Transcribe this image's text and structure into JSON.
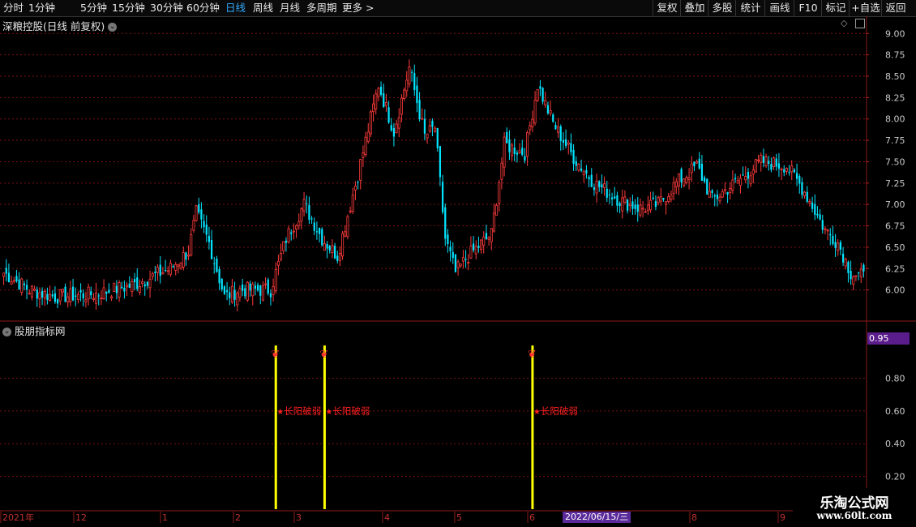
{
  "toolbar": {
    "periods": [
      "分时",
      "1分钟",
      "5分钟",
      "15分钟",
      "30分钟",
      "60分钟",
      "日线",
      "周线",
      "月线",
      "多周期",
      "更多 >"
    ],
    "active_period": "日线",
    "right": [
      "复权",
      "叠加",
      "多股",
      "统计",
      "画线",
      "F10",
      "标记",
      "+自选",
      "返回"
    ]
  },
  "main_panel": {
    "title": "深粮控股(日线 前复权)",
    "y_ticks": [
      "9.00",
      "8.75",
      "8.50",
      "8.25",
      "8.00",
      "7.75",
      "7.50",
      "7.25",
      "7.00",
      "6.75",
      "6.50",
      "6.25",
      "6.00"
    ]
  },
  "indicator_panel": {
    "title": "股朋指标网",
    "y_ticks": [
      "0.80",
      "0.60",
      "0.40",
      "0.20"
    ],
    "current_value": "0.95",
    "signal_label": "长阳破弱",
    "signals": [
      {
        "index": 106
      },
      {
        "index": 125
      },
      {
        "index": 206
      }
    ]
  },
  "x_axis": {
    "labels": [
      "2021年",
      "12",
      "1",
      "2",
      "3",
      "4",
      "5",
      "6",
      "2022/06/15/三",
      "8",
      "9"
    ]
  },
  "watermark": {
    "line1": "乐淘公式网",
    "line2": "www.60lt.com"
  },
  "colors": {
    "up": "#ff3b3b",
    "down": "#00e5ff",
    "grid": "#7a1010",
    "signal": "#ffff00",
    "label": "#ff2020"
  },
  "chart_data": {
    "type": "candlestick",
    "y_range": [
      5.75,
      9.05
    ],
    "indicator_range": [
      0,
      1.05
    ],
    "close_anchors": [
      [
        0,
        6.2
      ],
      [
        10,
        6.0
      ],
      [
        20,
        5.92
      ],
      [
        35,
        5.95
      ],
      [
        50,
        6.05
      ],
      [
        65,
        6.25
      ],
      [
        72,
        6.45
      ],
      [
        75,
        6.9
      ],
      [
        80,
        6.55
      ],
      [
        86,
        5.92
      ],
      [
        92,
        6.0
      ],
      [
        104,
        6.0
      ],
      [
        110,
        6.6
      ],
      [
        117,
        7.0
      ],
      [
        124,
        6.6
      ],
      [
        130,
        6.4
      ],
      [
        138,
        7.35
      ],
      [
        146,
        8.4
      ],
      [
        152,
        7.85
      ],
      [
        158,
        8.6
      ],
      [
        164,
        7.8
      ],
      [
        168,
        7.9
      ],
      [
        172,
        6.6
      ],
      [
        176,
        6.2
      ],
      [
        181,
        6.4
      ],
      [
        190,
        6.65
      ],
      [
        195,
        7.7
      ],
      [
        203,
        7.6
      ],
      [
        208,
        8.4
      ],
      [
        214,
        7.95
      ],
      [
        222,
        7.55
      ],
      [
        230,
        7.25
      ],
      [
        240,
        7.05
      ],
      [
        248,
        6.95
      ],
      [
        255,
        7.0
      ],
      [
        262,
        7.25
      ],
      [
        270,
        7.45
      ],
      [
        276,
        7.05
      ],
      [
        285,
        7.25
      ],
      [
        295,
        7.5
      ],
      [
        305,
        7.45
      ],
      [
        312,
        7.15
      ],
      [
        320,
        6.7
      ],
      [
        325,
        6.55
      ],
      [
        330,
        6.2
      ],
      [
        335,
        6.15
      ]
    ]
  }
}
